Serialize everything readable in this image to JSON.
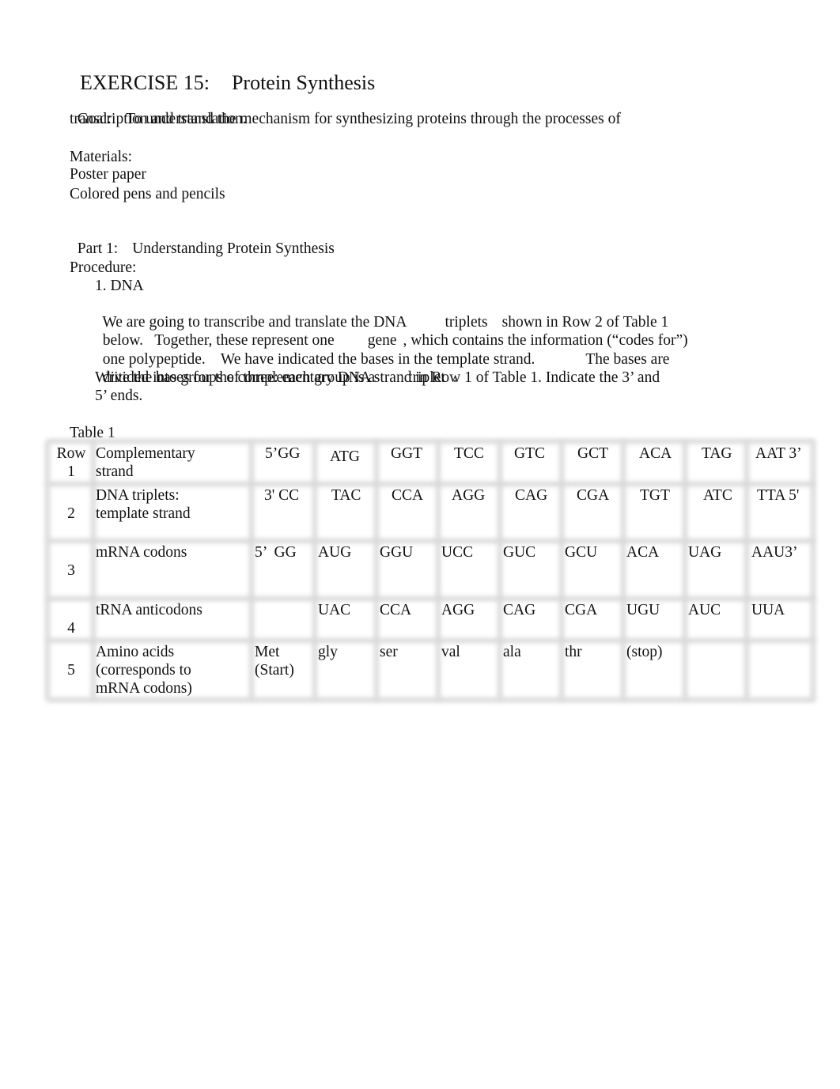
{
  "document": {
    "title": "EXERCISE 15:",
    "title_topic": "Protein Synthesis",
    "goal_label": "Goal:",
    "goal_line1": "To understand the mechanism for synthesizing proteins through the processes of",
    "goal_line2": "transcription and translation.",
    "materials_label": "Materials:",
    "materials": [
      "Poster paper",
      "Colored pens and pencils"
    ],
    "part_label": "Part 1:",
    "part_title": "Understanding Protein Synthesis",
    "procedure_label": "Procedure:",
    "step_heading": "1. DNA",
    "paragraph": {
      "l1a": "We are going to transcribe and translate the DNA",
      "l1b": "triplets",
      "l1c": "shown in Row 2 of Table 1",
      "l2a": "below.   Together, these represent one",
      "l2b": "gene",
      "l2c": ", which contains the information (“codes for”)",
      "l3a": "one polypeptide.    We have indicated the bases in the template strand.",
      "l3b": "The bases are",
      "l4a": "divided into groups of three: each group is a",
      "l4b": "triplet",
      "l4c": ".",
      "l5": "Write the bases for the complementary DNA strand in Row 1 of Table 1. Indicate the 3’ and",
      "l6": "5’ ends."
    },
    "table_caption": "Table 1"
  },
  "table": {
    "rows": [
      {
        "num_line1": "Row",
        "num_line2": "1",
        "label_line1": "Complementary",
        "label_line2": "strand",
        "label_line3": "",
        "cells": [
          "5’GG",
          "ATG",
          "GGT",
          "TCC",
          "GTC",
          "GCT",
          "ACA",
          "TAG",
          "AAT 3’"
        ]
      },
      {
        "num_line1": "",
        "num_line2": "2",
        "label_line1": "DNA triplets:",
        "label_line2": "template strand",
        "label_line3": "",
        "cells": [
          "3' CC",
          "TAC",
          "CCA",
          "AGG",
          "CAG",
          "CGA",
          "TGT",
          "ATC",
          "TTA 5'"
        ]
      },
      {
        "num_line1": "",
        "num_line2": "3",
        "label_line1": "mRNA codons",
        "label_line2": "",
        "label_line3": "",
        "cells": [
          "5’  GG",
          "AUG",
          "GGU",
          "UCC",
          "GUC",
          "GCU",
          "ACA",
          "UAG",
          "AAU3’"
        ]
      },
      {
        "num_line1": "",
        "num_line2": "4",
        "label_line1": "tRNA anticodons",
        "label_line2": "",
        "label_line3": "",
        "cells": [
          "",
          "UAC",
          "CCA",
          "AGG",
          "CAG",
          "CGA",
          "UGU",
          "AUC",
          "UUA"
        ]
      },
      {
        "num_line1": "",
        "num_line2": "5",
        "label_line1": "Amino acids",
        "label_line2": "(corresponds to",
        "label_line3": "mRNA codons)",
        "cells": [
          "Met\n(Start)",
          "gly",
          "ser",
          "val",
          "ala",
          "thr",
          "(stop)",
          "",
          ""
        ]
      }
    ]
  }
}
